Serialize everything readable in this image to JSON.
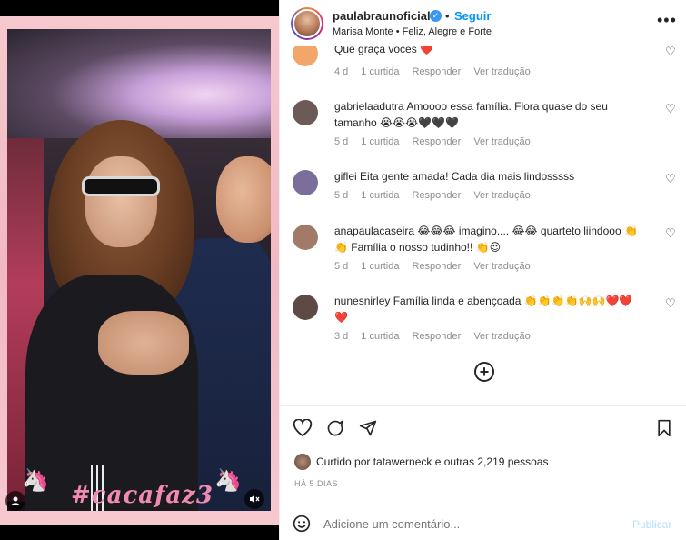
{
  "post": {
    "hashtag": "#cacafaz3",
    "username": "paulabraunoficial",
    "separator": "•",
    "follow_label": "Seguir",
    "subtitle": "Marisa Monte • Feliz, Alegre e Forte"
  },
  "comments": [
    {
      "user": "",
      "text": "Que graça vocês ❤️",
      "age": "4 d",
      "likes": "1 curtida",
      "reply": "Responder",
      "translate": "Ver tradução",
      "avatar_color": "#f3a66a"
    },
    {
      "user": "gabrielaadutra",
      "text": "Amoooo essa família. Flora quase do seu tamanho 😭😭😭🖤🖤🖤",
      "age": "5 d",
      "likes": "1 curtida",
      "reply": "Responder",
      "translate": "Ver tradução",
      "avatar_color": "#6b5a55"
    },
    {
      "user": "giflei",
      "text": "Eita gente amada! Cada dia mais lindosssss",
      "age": "5 d",
      "likes": "1 curtida",
      "reply": "Responder",
      "translate": "Ver tradução",
      "avatar_color": "#7b6e9a"
    },
    {
      "user": "anapaulacaseira",
      "text": "😂😂😂 imagino.... 😂😂 quarteto liindooo 👏👏 Família o nosso tudinho!! 👏😍",
      "age": "5 d",
      "likes": "1 curtida",
      "reply": "Responder",
      "translate": "Ver tradução",
      "avatar_color": "#a27a68"
    },
    {
      "user": "nunesnirley",
      "text": "Família linda e abençoada 👏👏👏👏🙌🙌❤️❤️❤️",
      "age": "3 d",
      "likes": "1 curtida",
      "reply": "Responder",
      "translate": "Ver tradução",
      "avatar_color": "#5d4a44"
    }
  ],
  "likes": {
    "text": "Curtido por tatawerneck e outras 2,219 pessoas"
  },
  "date": "HÁ 5 DIAS",
  "add_comment": {
    "placeholder": "Adicione um comentário...",
    "publish_label": "Publicar"
  },
  "icons": {
    "heart": "heart-icon",
    "comment": "comment-icon",
    "share": "share-icon",
    "save": "bookmark-icon",
    "emoji": "emoji-icon",
    "more": "more-options-icon",
    "load_more": "plus-circle-icon"
  },
  "colors": {
    "accent": "#0095f6",
    "publish_disabled": "#b2dffc",
    "meta_gray": "#8e8e8e",
    "hashtag_pink": "#f08ab0"
  }
}
